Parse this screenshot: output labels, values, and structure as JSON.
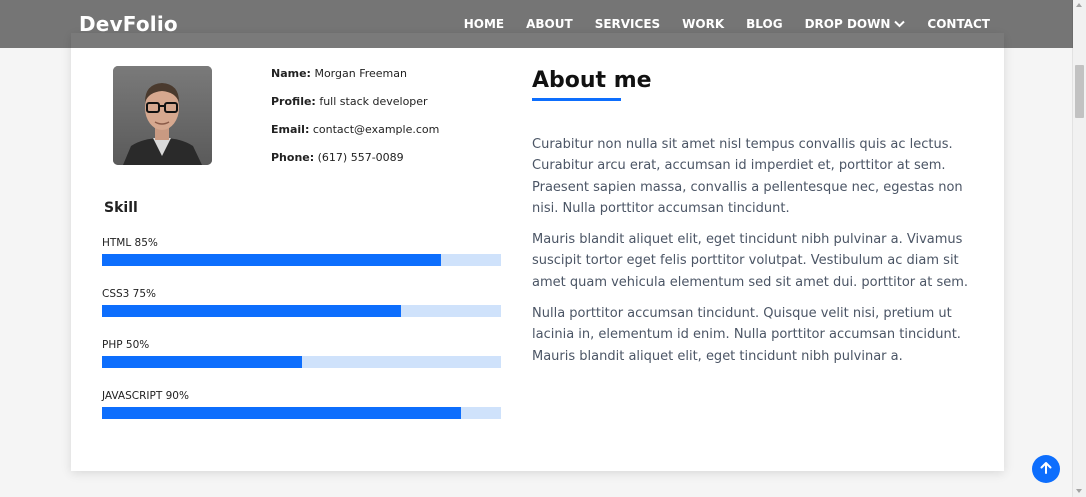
{
  "brand": "DevFolio",
  "nav": {
    "items": [
      "HOME",
      "ABOUT",
      "SERVICES",
      "WORK",
      "BLOG",
      "DROP DOWN",
      "CONTACT"
    ]
  },
  "profile": {
    "name_label": "Name:",
    "name": "Morgan Freeman",
    "profile_label": "Profile:",
    "profile": "full stack developer",
    "email_label": "Email:",
    "email": "contact@example.com",
    "phone_label": "Phone:",
    "phone": "(617) 557-0089"
  },
  "skills": {
    "title": "Skill",
    "items": [
      {
        "label": "HTML 85%",
        "percent": 85
      },
      {
        "label": "CSS3 75%",
        "percent": 75
      },
      {
        "label": "PHP 50%",
        "percent": 50
      },
      {
        "label": "JAVASCRIPT 90%",
        "percent": 90
      }
    ]
  },
  "about": {
    "title": "About me",
    "paragraphs": [
      "Curabitur non nulla sit amet nisl tempus convallis quis ac lectus. Curabitur arcu erat, accumsan id imperdiet et, porttitor at sem. Praesent sapien massa, convallis a pellentesque nec, egestas non nisi. Nulla porttitor accumsan tincidunt.",
      "Mauris blandit aliquet elit, eget tincidunt nibh pulvinar a. Vivamus suscipit tortor eget felis porttitor volutpat. Vestibulum ac diam sit amet quam vehicula elementum sed sit amet dui. porttitor at sem.",
      "Nulla porttitor accumsan tincidunt. Quisque velit nisi, pretium ut lacinia in, elementum id enim. Nulla porttitor accumsan tincidunt. Mauris blandit aliquet elit, eget tincidunt nibh pulvinar a."
    ]
  },
  "colors": {
    "accent": "#0d6efd",
    "track": "#cfe2fb"
  },
  "icons": {
    "dropdown": "chevron-down-icon",
    "back_to_top": "arrow-up-icon"
  }
}
